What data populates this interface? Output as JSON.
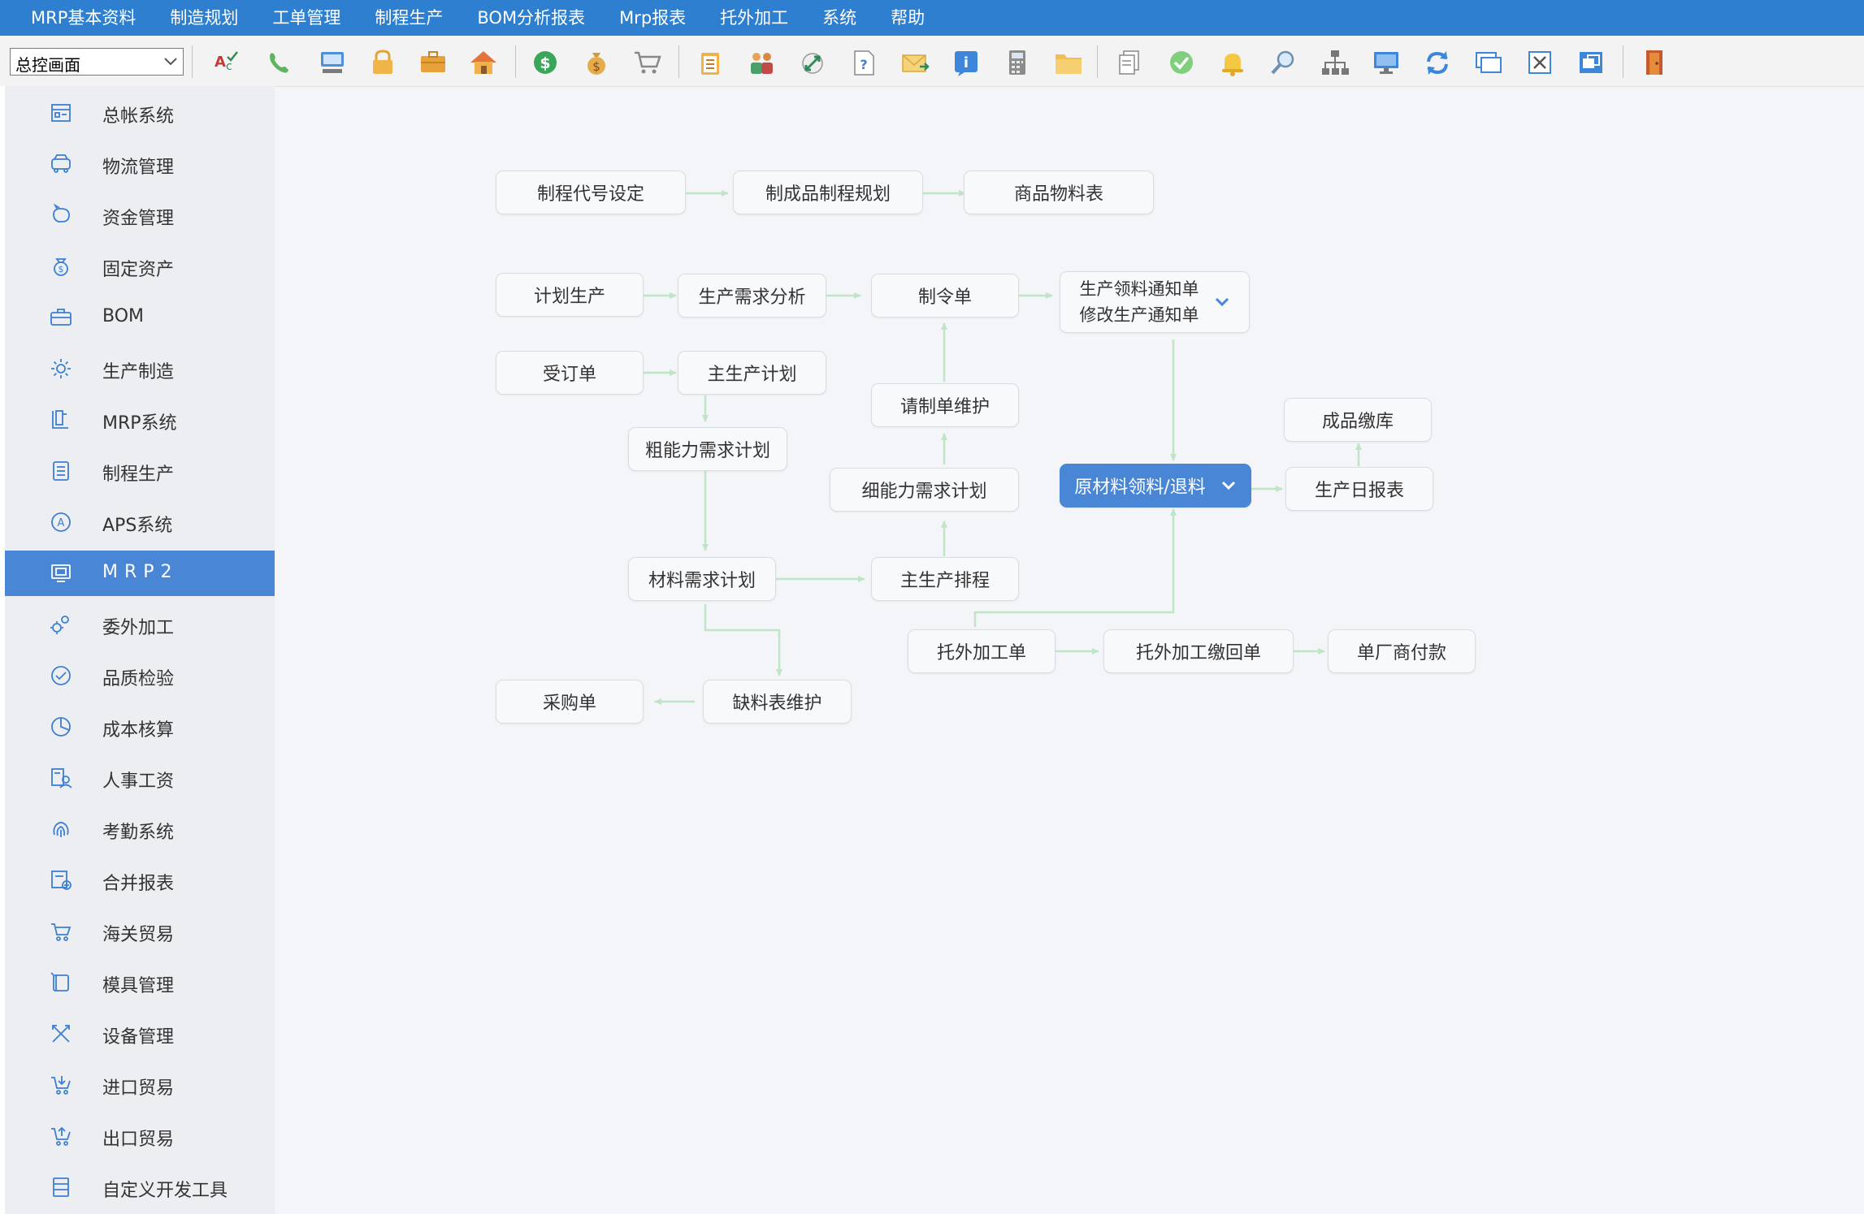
{
  "menu": [
    "MRP基本资料",
    "制造规划",
    "工单管理",
    "制程生产",
    "BOM分析报表",
    "Mrp报表",
    "托外加工",
    "系统",
    "帮助"
  ],
  "toolbar": {
    "view_select": "总控画面",
    "tools": [
      "spellcheck-icon",
      "phone-icon",
      "computer-icon",
      "lock-icon",
      "briefcase-icon",
      "home-icon",
      "dollar-icon",
      "money-bag-icon",
      "cart-icon",
      "clipboard-icon",
      "users-icon",
      "link-icon",
      "help-doc-icon",
      "mail-icon",
      "info-icon",
      "calculator-icon",
      "folder-icon",
      "documents-icon",
      "check-icon",
      "bell-icon",
      "search-icon",
      "org-chart-icon",
      "monitor-icon",
      "refresh-icon",
      "window-icon",
      "close-window-icon",
      "restore-window-icon",
      "exit-door-icon"
    ]
  },
  "sidebar": [
    {
      "label": "总帐系统",
      "icon": "ledger-icon"
    },
    {
      "label": "物流管理",
      "icon": "truck-icon"
    },
    {
      "label": "资金管理",
      "icon": "piggy-bank-icon"
    },
    {
      "label": "固定资产",
      "icon": "asset-bag-icon"
    },
    {
      "label": "BOM",
      "icon": "toolbox-icon"
    },
    {
      "label": "生产制造",
      "icon": "gear-icon"
    },
    {
      "label": "MRP系统",
      "icon": "book-icon"
    },
    {
      "label": "制程生产",
      "icon": "list-doc-icon"
    },
    {
      "label": "APS系统",
      "icon": "circle-a-icon"
    },
    {
      "label": "MRP2",
      "icon": "monitor-icon",
      "active": true
    },
    {
      "label": "委外加工",
      "icon": "gears-icon"
    },
    {
      "label": "品质检验",
      "icon": "check-circle-icon"
    },
    {
      "label": "成本核算",
      "icon": "pie-chart-icon"
    },
    {
      "label": "人事工资",
      "icon": "person-doc-icon"
    },
    {
      "label": "考勤系统",
      "icon": "fingerprint-icon"
    },
    {
      "label": "合并报表",
      "icon": "report-add-icon"
    },
    {
      "label": "海关贸易",
      "icon": "cart-icon"
    },
    {
      "label": "模具管理",
      "icon": "mold-icon"
    },
    {
      "label": "设备管理",
      "icon": "tools-icon"
    },
    {
      "label": "进口贸易",
      "icon": "cart-in-icon"
    },
    {
      "label": "出口贸易",
      "icon": "cart-out-icon"
    },
    {
      "label": "自定义开发工具",
      "icon": "form-icon"
    }
  ],
  "flow": {
    "process_code": "制程代号设定",
    "product_routing": "制成品制程规划",
    "item_bom": "商品物料表",
    "plan_production": "计划生产",
    "demand_analysis": "生产需求分析",
    "work_order": "制令单",
    "pick_notice_1": "生产领料通知单",
    "pick_notice_2": "修改生产通知单",
    "sales_order": "受订单",
    "mps": "主生产计划",
    "request_order": "请制单维护",
    "finished_stock": "成品缴库",
    "rccp": "粗能力需求计划",
    "crp": "细能力需求计划",
    "material_issue": "原材料领料/退料",
    "daily_report": "生产日报表",
    "mrp": "材料需求计划",
    "schedule": "主生产排程",
    "outsource_order": "托外加工单",
    "outsource_return": "托外加工缴回单",
    "vendor_payment": "单厂商付款",
    "purchase_order": "采购单",
    "shortage": "缺料表维护"
  },
  "colors": {
    "menubar": "#2e7fcf",
    "active": "#4a86d6",
    "arrow": "#bfe5c6"
  }
}
